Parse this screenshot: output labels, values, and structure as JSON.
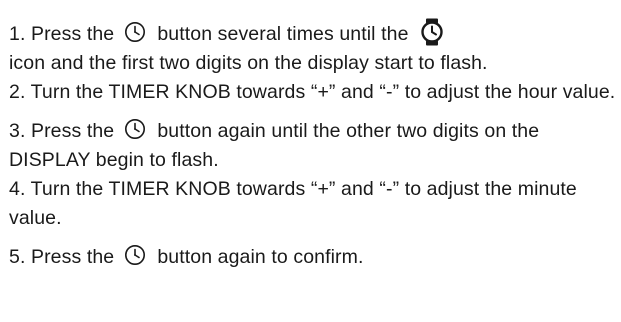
{
  "steps": [
    {
      "line1_before": "1. Press the",
      "line1_mid": "button several times until the",
      "line1_after": "icon and the first two digits on the display start to flash.",
      "icon_button": "clock-button-icon",
      "icon_display": "clock-display-icon"
    },
    {
      "text": "2. Turn the TIMER KNOB towards “+” and “-” to adjust the hour value."
    },
    {
      "before": "3. Press the",
      "after": "button again until the other two digits on the DISPLAY begin to flash.",
      "icon_button": "clock-button-icon"
    },
    {
      "text": "4. Turn the TIMER KNOB towards “+” and “-” to adjust the minute value."
    },
    {
      "before": "5. Press the",
      "after": "button again to confirm.",
      "icon_button": "clock-button-icon"
    }
  ],
  "colors": {
    "text": "#1a1a1a",
    "background": "#ffffff"
  }
}
